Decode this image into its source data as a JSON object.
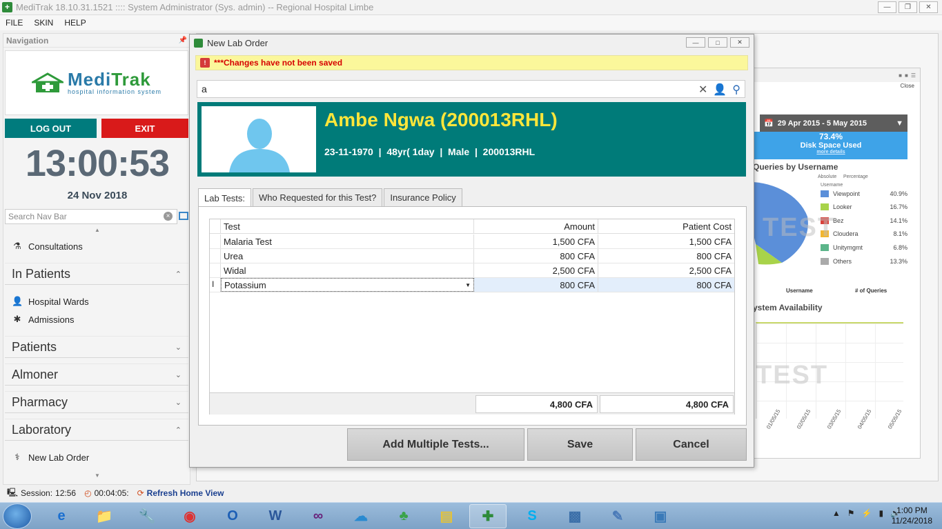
{
  "window": {
    "title": "MediTrak 18.10.31.1521 :::: System Administrator (Sys. admin) -- Regional Hospital Limbe",
    "controls": [
      "minimize",
      "restore",
      "close"
    ]
  },
  "menu": [
    "FILE",
    "SKIN",
    "HELP"
  ],
  "nav": {
    "header": "Navigation",
    "logo_brand_a": "Medi",
    "logo_brand_b": "Trak",
    "logo_sub": "hospital information system",
    "logout_label": "LOG OUT",
    "exit_label": "EXIT",
    "clock": "13:00:53",
    "date": "24 Nov 2018",
    "search_placeholder": "Search Nav Bar",
    "consultations": "Consultations",
    "groups": {
      "in_patients": "In Patients",
      "patients": "Patients",
      "almoner": "Almoner",
      "pharmacy": "Pharmacy",
      "laboratory": "Laboratory"
    },
    "hospital_wards": "Hospital Wards",
    "admissions": "Admissions",
    "new_lab_order": "New Lab Order"
  },
  "dashboard": {
    "close": "Close",
    "date_range": "29 Apr 2015 - 5 May 2015",
    "disk_pct": "73.4%",
    "disk_label": "Disk Space Used",
    "disk_more": "more details",
    "queries_title": "Queries by Username",
    "legend_absolute": "Absolute",
    "legend_percentage": "Percentage",
    "legend_username": "Username",
    "legend": [
      {
        "name": "Viewpoint",
        "pct": "40.9%",
        "color": "#5b8fd9"
      },
      {
        "name": "Looker",
        "pct": "16.7%",
        "color": "#a8d34a"
      },
      {
        "name": "Bez",
        "pct": "14.1%",
        "color": "#d9413a"
      },
      {
        "name": "Cloudera",
        "pct": "8.1%",
        "color": "#f2b630"
      },
      {
        "name": "Unitymgmt",
        "pct": "6.8%",
        "color": "#5cb58a"
      },
      {
        "name": "Others",
        "pct": "13.3%",
        "color": "#aaaaaa"
      }
    ],
    "col_username": "Username",
    "col_queries": "# of Queries",
    "watermark": "TEST",
    "availability_title": "ystem Availability",
    "axis_dates": [
      "01/05/15",
      "02/05/15",
      "03/05/15",
      "04/05/15",
      "05/05/15"
    ]
  },
  "dialog": {
    "title": "New Lab Order",
    "warning": "***Changes have not been saved",
    "search_value": "a",
    "patient": {
      "name": "Ambe Ngwa (200013RHL)",
      "info": "23-11-1970  |  48yr( 1day  |  Male  |  200013RHL"
    },
    "tabs": [
      "Lab Tests:",
      "Who Requested for this Test?",
      "Insurance Policy"
    ],
    "columns": {
      "test": "Test",
      "amount": "Amount",
      "patient_cost": "Patient Cost"
    },
    "rows": [
      {
        "test": "Malaria Test",
        "amount": "1,500 CFA",
        "cost": "1,500 CFA"
      },
      {
        "test": "Urea",
        "amount": "800 CFA",
        "cost": "800 CFA"
      },
      {
        "test": "Widal",
        "amount": "2,500 CFA",
        "cost": "2,500 CFA"
      },
      {
        "test": "Potassium",
        "amount": "800 CFA",
        "cost": "800 CFA"
      }
    ],
    "total_amount": "4,800 CFA",
    "total_cost": "4,800 CFA",
    "buttons": {
      "add_multiple": "Add Multiple Tests...",
      "save": "Save",
      "cancel": "Cancel"
    }
  },
  "status": {
    "session_label": "Session:",
    "session_time": "12:56",
    "timer": "00:04:05:",
    "refresh": "Refresh Home View"
  },
  "taskbar": {
    "time": "1:00 PM",
    "date": "11/24/2018"
  }
}
